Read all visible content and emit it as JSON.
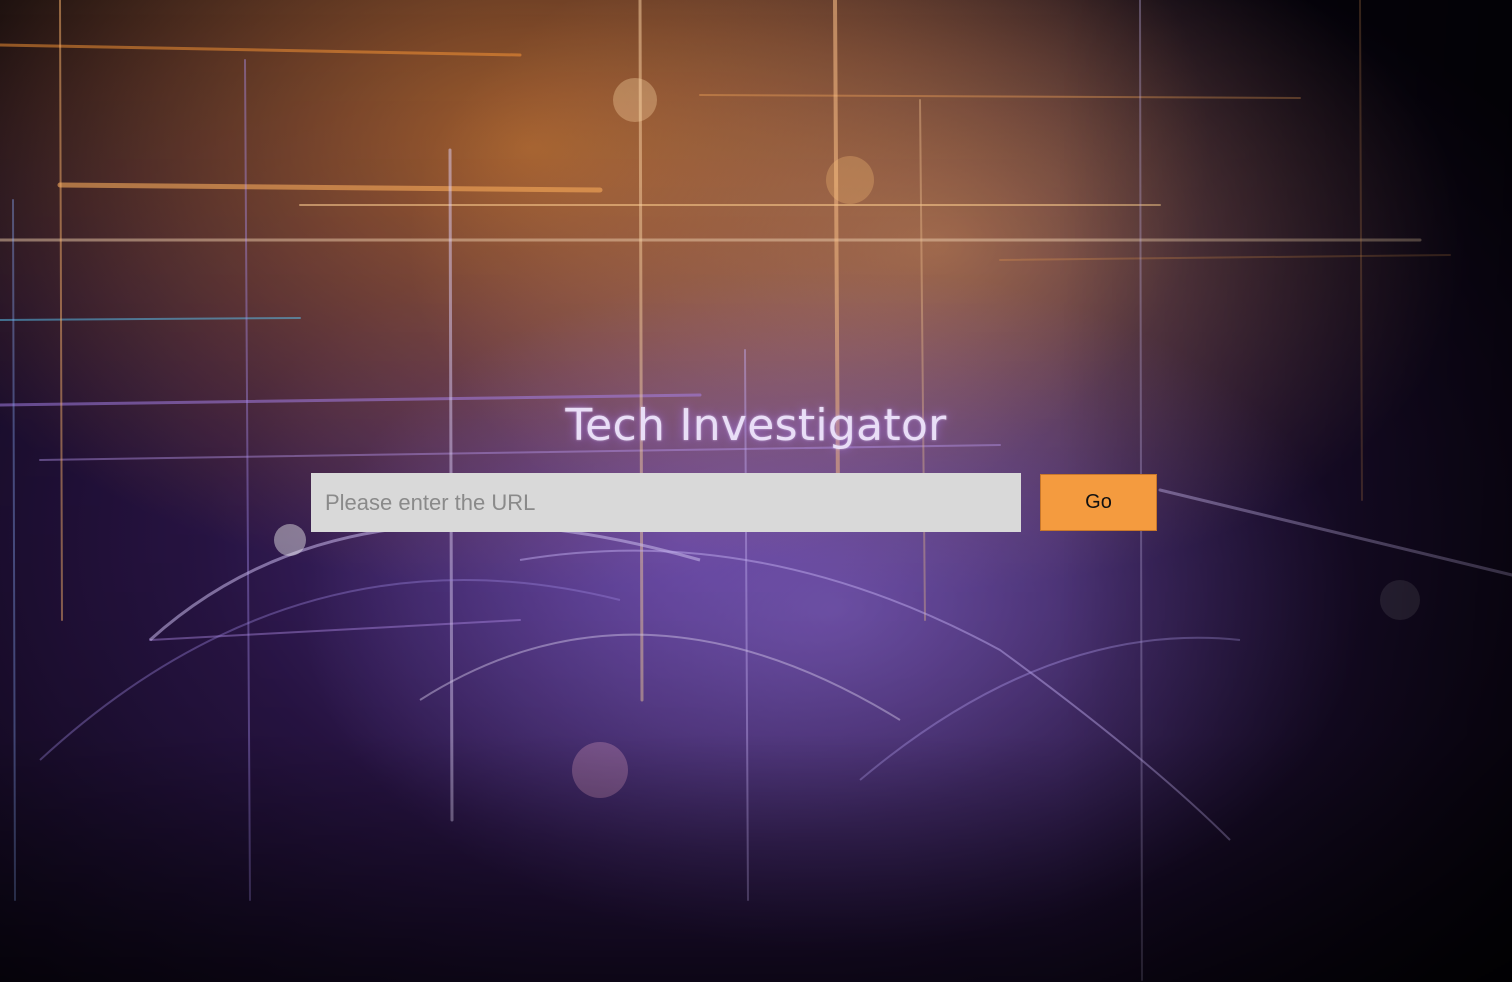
{
  "app": {
    "title": "Tech Investigator"
  },
  "search": {
    "placeholder": "Please enter the URL",
    "value": "",
    "submit_label": "Go"
  },
  "colors": {
    "button_bg": "#f49b3f",
    "input_bg": "#d9d9d9",
    "title_color": "#e9def7"
  }
}
